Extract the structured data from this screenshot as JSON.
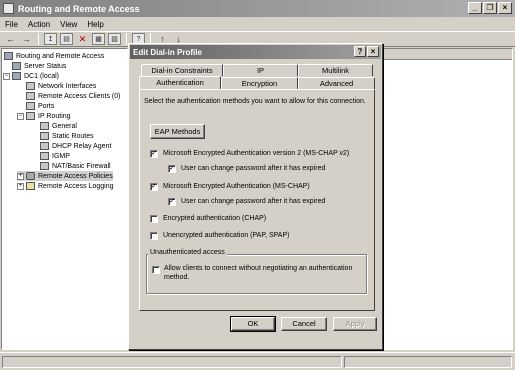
{
  "app": {
    "title": "Routing and Remote Access",
    "window_buttons": [
      "_",
      "р",
      "×"
    ]
  },
  "menu": [
    "File",
    "Action",
    "View",
    "Help"
  ],
  "toolbar": {
    "back": "←",
    "forward": "→",
    "up": "↥",
    "properties": "▤",
    "delete": "✕",
    "export": "▦",
    "refresh": "▧",
    "help": "?",
    "move_up": "↑",
    "move_down": "↓"
  },
  "tree": {
    "root": "Routing and Remote Access",
    "items": [
      "Server Status",
      "DC1 (local)",
      "Network Interfaces",
      "Remote Access Clients (0)",
      "Ports",
      "IP Routing",
      "General",
      "Static Routes",
      "DHCP Relay Agent",
      "IGMP",
      "NAT/Basic Firewall",
      "Remote Access Policies",
      "Remote Access Logging"
    ]
  },
  "dialog": {
    "title": "Edit Dial-in Profile",
    "help_btn": "?",
    "close_btn": "×",
    "tabs_back": [
      "Dial-in Constraints",
      "IP",
      "Multilink"
    ],
    "tabs_front": [
      "Authentication",
      "Encryption",
      "Advanced"
    ],
    "active_tab": "Authentication",
    "instructions": "Select the authentication methods you want to allow for this connection.",
    "eap_button": "EAP Methods",
    "options": [
      {
        "label": "Microsoft Encrypted Authentication version 2 (MS-CHAP v2)",
        "checked": true
      },
      {
        "label": "User can change password after it has expired",
        "checked": true
      },
      {
        "label": "Microsoft Encrypted Authentication (MS-CHAP)",
        "checked": true
      },
      {
        "label": "User can change password after it has expired",
        "checked": true
      },
      {
        "label": "Encrypted authentication (CHAP)",
        "checked": false
      },
      {
        "label": "Unencrypted authentication (PAP, SPAP)",
        "checked": false
      }
    ],
    "unauth_group": "Unauthenticated access",
    "unauth_option": {
      "label_line1": "Allow clients to connect without negotiating an authentication",
      "label_line2": "method.",
      "checked": false
    },
    "ok": "OK",
    "cancel": "Cancel",
    "apply": "Apply",
    "check_mark": "✓"
  }
}
